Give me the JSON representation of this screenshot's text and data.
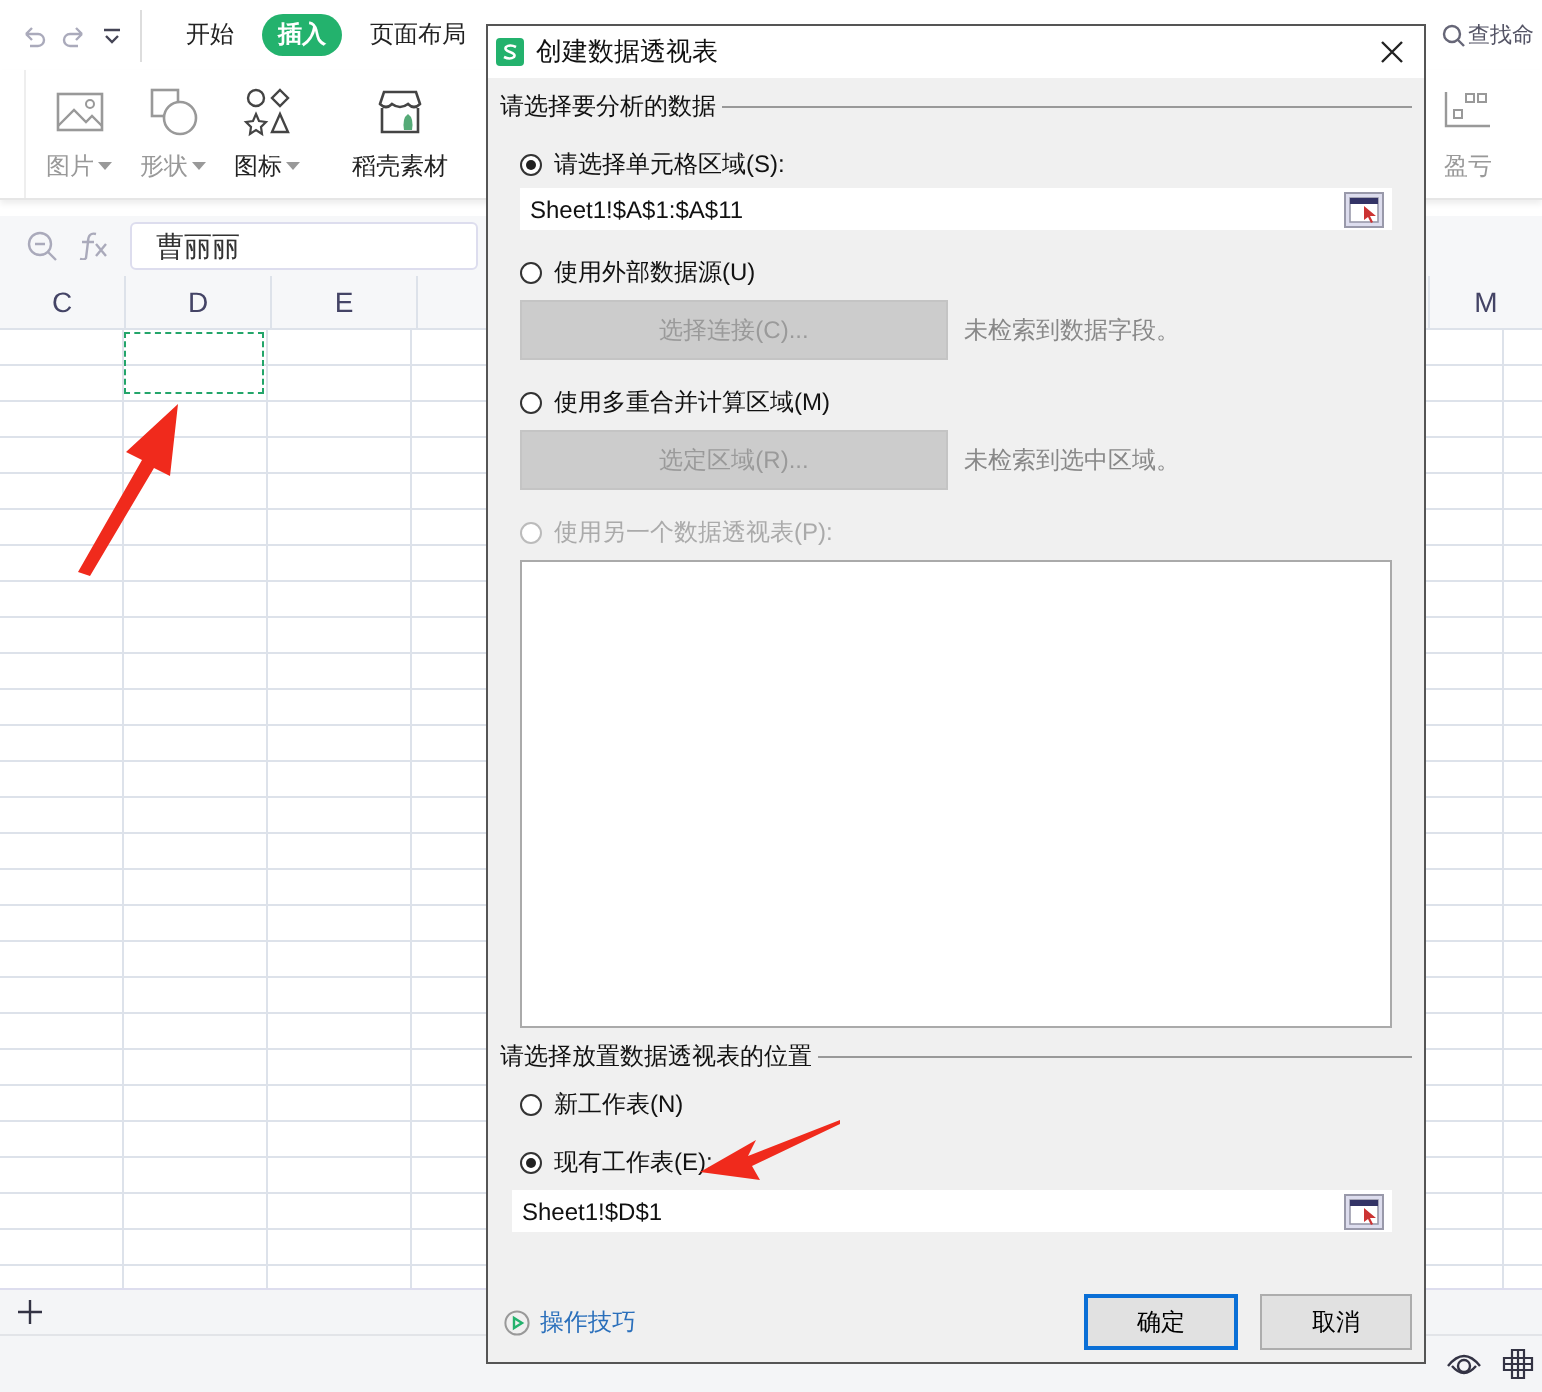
{
  "quick_access": {
    "tabs": [
      {
        "label": "开始",
        "selected": false
      },
      {
        "label": "插入",
        "selected": true
      },
      {
        "label": "页面布局",
        "selected": false
      }
    ],
    "search": {
      "placeholder": "查找命"
    }
  },
  "ribbon": {
    "items": [
      {
        "label": "图片",
        "dropdown": true,
        "disabled": true
      },
      {
        "label": "形状",
        "dropdown": true,
        "disabled": true
      },
      {
        "label": "图标",
        "dropdown": true,
        "disabled": false
      },
      {
        "label": "稻壳素材",
        "dropdown": false,
        "disabled": false
      }
    ],
    "right_items": [
      {
        "label": "盈亏",
        "dropdown": false,
        "disabled": true
      }
    ]
  },
  "formula_bar": {
    "value": "曹丽丽"
  },
  "sheet": {
    "columns_left": [
      "C",
      "D",
      "E"
    ],
    "columns_right": [
      "M"
    ]
  },
  "dialog": {
    "title": "创建数据透视表",
    "source": {
      "heading": "请选择要分析的数据",
      "options": [
        {
          "kind": "range",
          "label": "请选择单元格区域(S):",
          "selected": true,
          "disabled": false,
          "value": "Sheet1!$A$1:$A$11"
        },
        {
          "kind": "action",
          "label": "使用外部数据源(U)",
          "selected": false,
          "disabled": false,
          "button": "选择连接(C)...",
          "note": "未检索到数据字段。"
        },
        {
          "kind": "action",
          "label": "使用多重合并计算区域(M)",
          "selected": false,
          "disabled": false,
          "button": "选定区域(R)...",
          "note": "未检索到选中区域。"
        },
        {
          "kind": "list",
          "label": "使用另一个数据透视表(P):",
          "selected": false,
          "disabled": true
        }
      ]
    },
    "target": {
      "heading": "请选择放置数据透视表的位置",
      "options": [
        {
          "kind": "plain",
          "label": "新工作表(N)",
          "selected": false,
          "disabled": false
        },
        {
          "kind": "range",
          "label": "现有工作表(E):",
          "selected": true,
          "disabled": false,
          "value": "Sheet1!$D$1"
        }
      ]
    },
    "tips_link": "操作技巧",
    "buttons": [
      {
        "label": "确定",
        "default": true
      },
      {
        "label": "取消",
        "default": false
      }
    ]
  }
}
